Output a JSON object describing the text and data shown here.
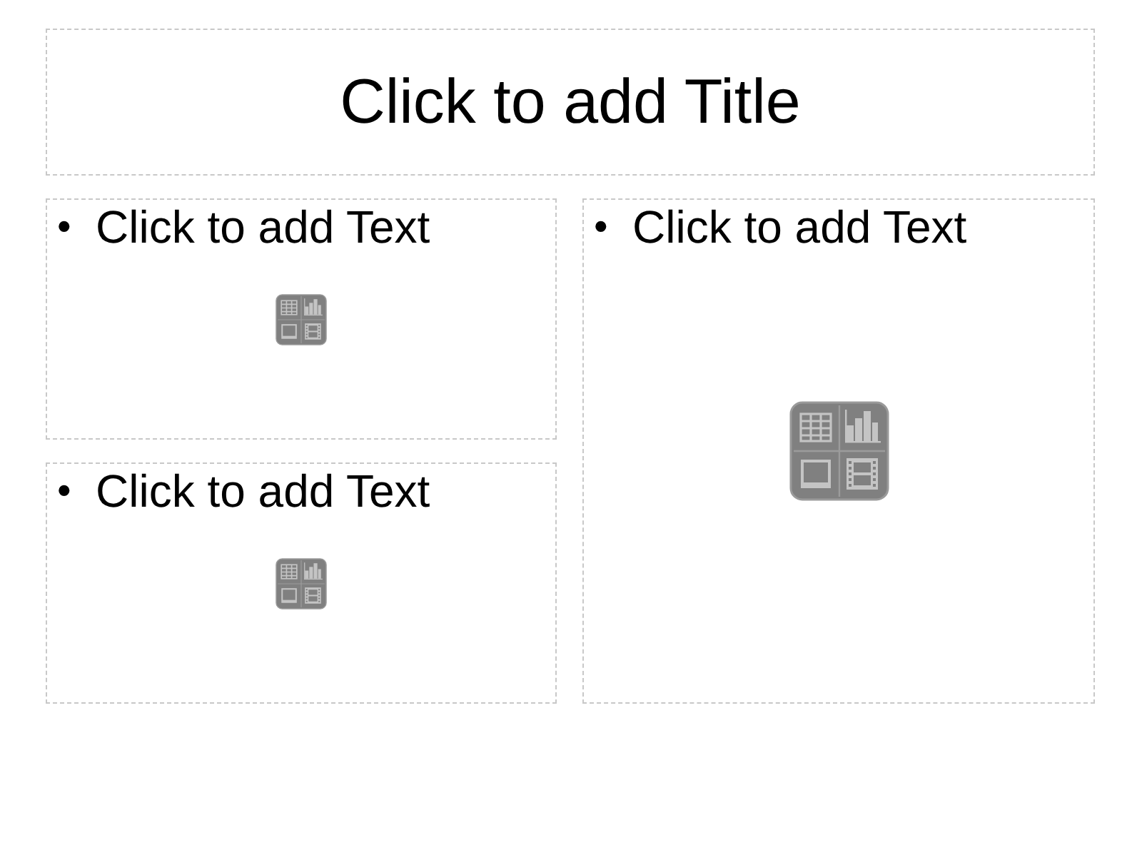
{
  "title": {
    "placeholder": "Click to add Title"
  },
  "placeholders": [
    {
      "bullet": "•",
      "text": "Click to add Text",
      "kind": "small"
    },
    {
      "bullet": "•",
      "text": "Click to add Text",
      "kind": "small"
    },
    {
      "bullet": "•",
      "text": "Click to add Text",
      "kind": "large"
    }
  ]
}
